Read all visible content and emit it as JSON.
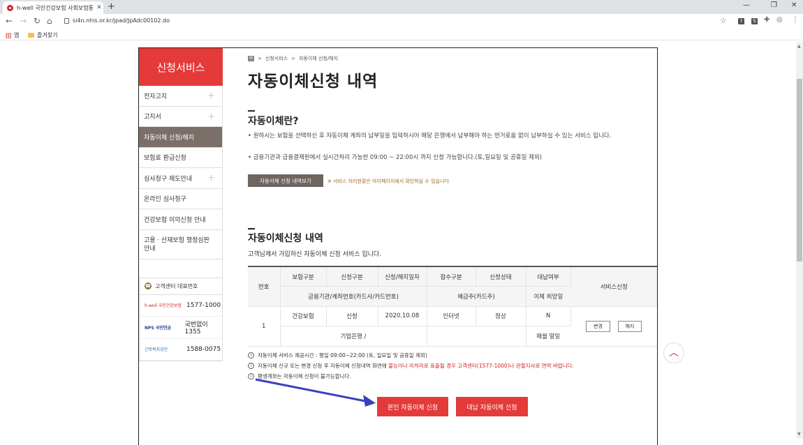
{
  "browser": {
    "tab_title": "h-well 국민건강보험 사회보험통",
    "tab_close": "✕",
    "new_tab": "+",
    "url": "si4n.nhis.or.kr/jpad/JpAdc00102.do",
    "bookmarks": [
      {
        "label": "앱"
      },
      {
        "label": "즐겨찾기"
      }
    ]
  },
  "sidebar": {
    "title": "신청서비스",
    "items": [
      {
        "label": "전자고지"
      },
      {
        "label": "고지서"
      },
      {
        "label": "자동이체 신청/해지"
      },
      {
        "label": "보험료 환급신청"
      },
      {
        "label": "심사청구 제도안내"
      },
      {
        "label": "온라인 심사청구"
      },
      {
        "label": "건강보험 이의신청 안내"
      },
      {
        "label": "고용ㆍ산재보험 행정심판안내"
      }
    ],
    "contact": {
      "title": "고객센터 대표번호",
      "rows": [
        {
          "org": "h-well 국민건강보험",
          "phone": "1577-1000"
        },
        {
          "org": "NPS 국민연금",
          "phone": "국번없이1355"
        },
        {
          "org": "근로복지공단",
          "phone": "1588-0075"
        }
      ]
    }
  },
  "breadcrumb": {
    "home": "H",
    "level1": "신청서비스",
    "level2": "자동이체 신청/해지",
    "sep": ">"
  },
  "page_title": "자동이체신청 내역",
  "section1": {
    "title": "자동이체란?",
    "bullets": [
      "• 원하시는 보험을 선택하신 후 자동이체 계좌의 납부일을 입력하시어 매달 은행에서 납부해야 하는 번거로움 없이 납부하실 수 있는 서비스 입니다.",
      "• 금융기관과 금융결제원에서 실시간처리 가능한 09:00 ~ 22:00시 까지 신청 가능합니다.(토,일요일 및 공휴일 제외)"
    ],
    "history_button": "자동이체 신청 내역보기",
    "history_note": "※ 서비스 처리현황은 마이페이지에서 확인하실 수 있습니다."
  },
  "section2": {
    "title": "자동이체신청 내역",
    "subtitle": "고객님께서 가입하신 자동이체 신청 서비스 입니다.",
    "table": {
      "headers_row1": [
        "번호",
        "보험구분",
        "신청구분",
        "신청/해지일자",
        "접수구분",
        "신청상태",
        "대납여부",
        "서비스신청"
      ],
      "headers_row2": [
        "금융기관/계좌번호(카드사/카드번호)",
        "예금주(카드주)",
        "이체 희망일"
      ],
      "rows": [
        {
          "no": "1",
          "insurance": "건강보험",
          "apply_type": "신청",
          "date": "2020.10.08",
          "receipt": "인터넷",
          "status": "정상",
          "proxy": "N",
          "bank": "기업은행 /",
          "holder": "",
          "transfer_day": "매월 말일",
          "change_btn": "변경",
          "cancel_btn": "해지"
        }
      ]
    },
    "notes": [
      {
        "text": "자동이체 서비스 제공시간 : 평일 09:00~22:00 (토, 일요일 및 공휴일 제외)"
      },
      {
        "text_a": "자동이체 신규 또는 변경 신청 후 자동이체 신청내역 화면에 ",
        "text_b": "불능이나 미처리로 표출될 경우 고객센터(1577-1000)나 관할지사로 연락 바랍니다."
      },
      {
        "text": "평생계좌는 자동이체 신청이 불가능합니다."
      }
    ],
    "self_apply_button": "본인 자동이체 신청",
    "proxy_apply_button": "대납 자동이체 신청"
  },
  "colors": {
    "brand_red": "#e53a3a",
    "active_brown": "#7b6f69",
    "arrow_blue": "#3b3fbf"
  }
}
